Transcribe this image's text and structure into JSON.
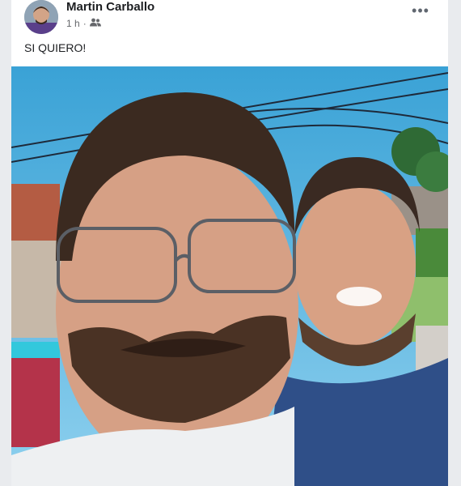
{
  "post": {
    "author": "Martin Carballo",
    "time": "1 h",
    "separator": "·",
    "audience_icon": "friends-icon",
    "more_icon": "more-options-icon",
    "more_label": "•••",
    "text": "SI QUIERO!",
    "photo_description_icon": "selfie-photo"
  },
  "colors": {
    "sky": "#3ea8d8",
    "card": "#ffffff",
    "background": "#e9ebee",
    "text": "#1c1e21",
    "meta": "#65676b"
  }
}
